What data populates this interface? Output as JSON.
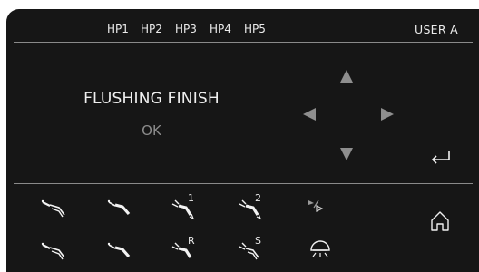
{
  "header": {
    "handpieces": [
      "HP1",
      "HP2",
      "HP3",
      "HP4",
      "HP5"
    ],
    "user": "USER A"
  },
  "main": {
    "message": "FLUSHING FINISH",
    "confirm": "OK"
  },
  "tools": {
    "row1_labels": [
      "1",
      "2"
    ],
    "row2_labels": [
      "R",
      "S"
    ]
  },
  "colors": {
    "background": "#161616",
    "text": "#ececec",
    "dim": "#8c8c8c"
  },
  "icons": [
    "arrow-up-icon",
    "arrow-down-icon",
    "arrow-left-icon",
    "arrow-right-icon",
    "enter-icon",
    "home-icon",
    "light-icon"
  ]
}
